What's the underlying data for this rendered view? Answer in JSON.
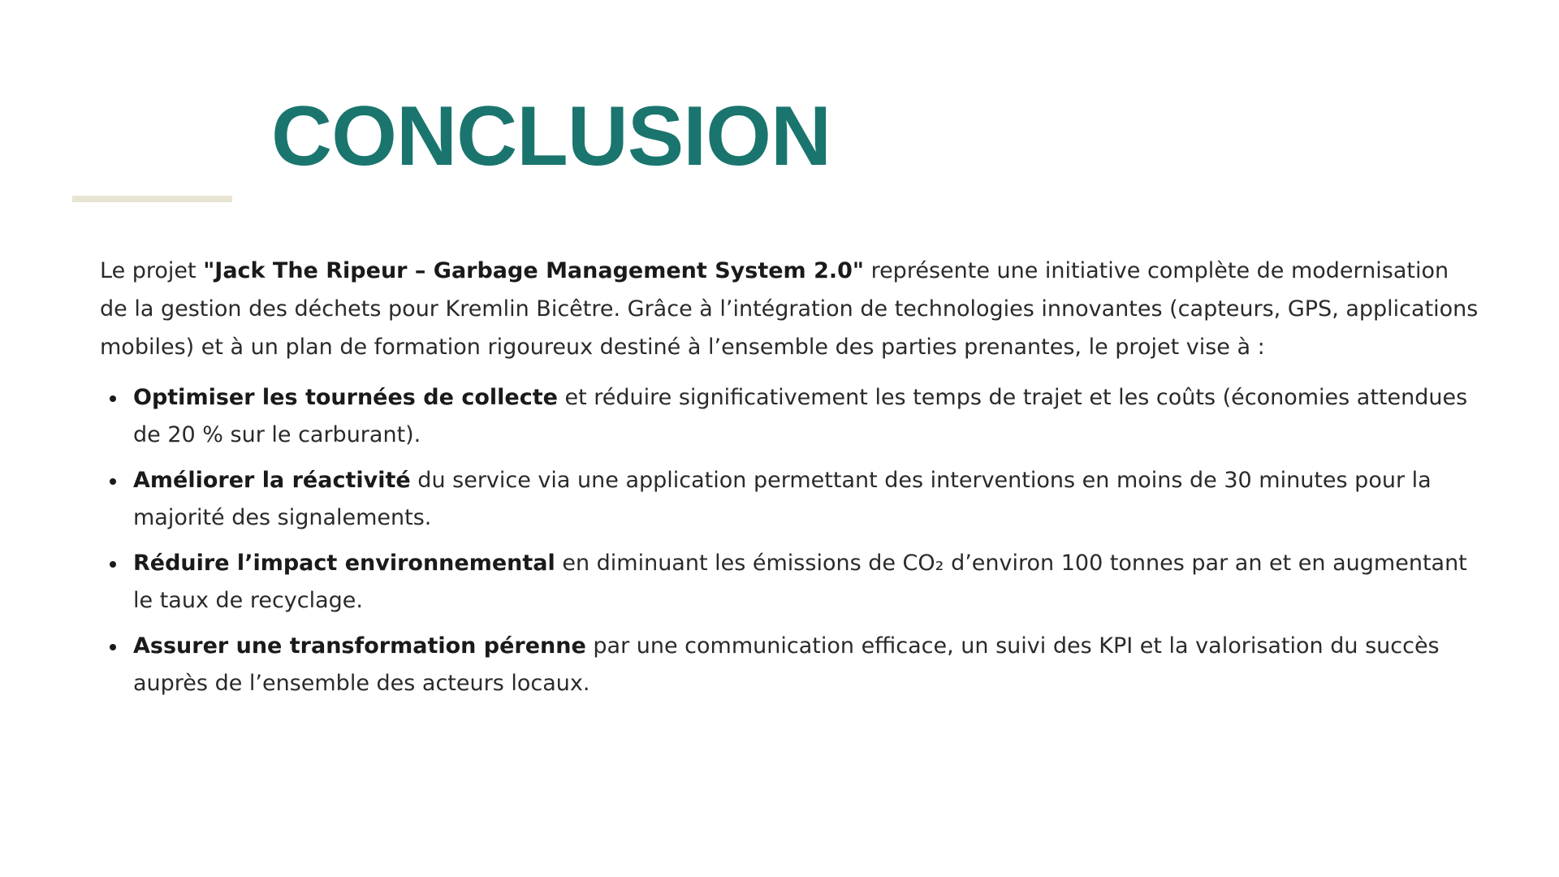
{
  "slide": {
    "title": "CONCLUSION",
    "intro": {
      "before": "Le projet ",
      "project_name": "\"Jack The Ripeur – Garbage Management System 2.0\"",
      "after": " représente une initiative complète de modernisation de la gestion des déchets pour Kremlin Bicêtre. Grâce à l’intégration de technologies innovantes (capteurs, GPS, applications mobiles) et à un plan de formation rigoureux destiné à l’ensemble des parties prenantes, le projet vise à :"
    },
    "bullets": [
      {
        "bold": "Optimiser les tournées de collecte",
        "text": " et réduire significativement les temps de trajet et les coûts (économies attendues de 20 % sur le carburant)."
      },
      {
        "bold": "Améliorer la réactivité",
        "text": " du service via une application permettant des interventions en moins de 30 minutes pour la majorité des signalements."
      },
      {
        "bold": "Réduire l’impact environnemental",
        "text": " en diminuant les émissions de CO₂ d’environ 100 tonnes par an et en augmentant le taux de recyclage."
      },
      {
        "bold": "Assurer une transformation pérenne",
        "text": " par une communication efficace, un suivi des KPI et la valorisation du succès auprès de l’ensemble des acteurs locaux."
      }
    ]
  },
  "colors": {
    "title": "#1a756e",
    "accent_rule": "#e8e4d2",
    "text": "#2a2a2a"
  }
}
